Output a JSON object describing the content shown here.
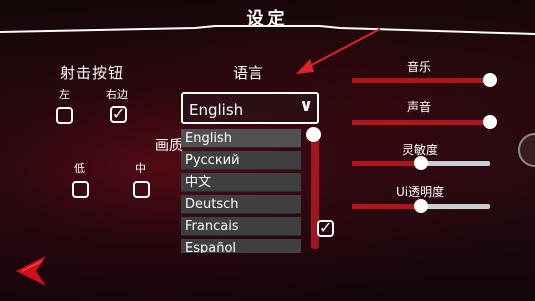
{
  "header": {
    "title": "设定"
  },
  "fire_buttons": {
    "label": "射击按钮",
    "left_label": "左",
    "right_label": "右边",
    "left_checked": false,
    "right_checked": true
  },
  "quality": {
    "label": "画质",
    "low_label": "低",
    "mid_label": "中",
    "low_checked": false,
    "mid_checked": false
  },
  "language": {
    "label": "语言",
    "selected": "English",
    "options": [
      "English",
      "Русский",
      "中文",
      "Deutsch",
      "Francais",
      "Español"
    ],
    "extra_checked": true
  },
  "sliders": {
    "music": {
      "label": "音乐",
      "value": 1.0
    },
    "sound": {
      "label": "声音",
      "value": 1.0
    },
    "sensitivity": {
      "label": "灵敏度",
      "value": 0.5
    },
    "ui_opacity": {
      "label": "Ui透明度",
      "value": 0.5
    }
  },
  "colors": {
    "accent": "#b0141f",
    "track": "#c9cfd4",
    "annotation_arrow": "#e0202c",
    "back_arrow": "#d0101c"
  },
  "icons": {
    "back": "back-arrow-icon",
    "dropdown": "chevron-down-icon",
    "annotation": "red-pointer-arrow"
  }
}
